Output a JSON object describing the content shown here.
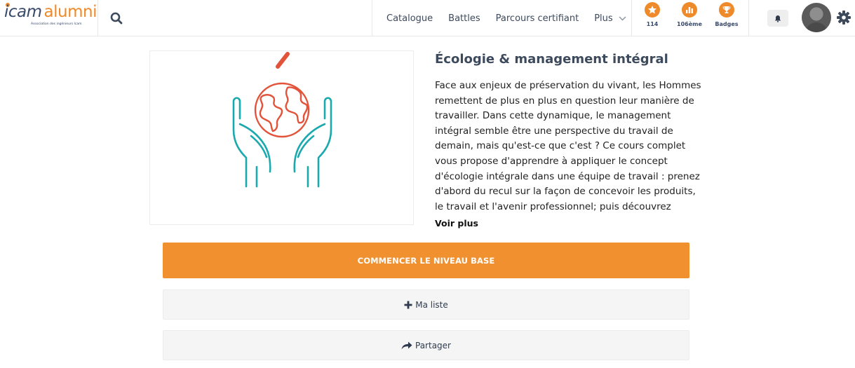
{
  "header": {
    "logo_word1": "icam",
    "logo_word2": "alumni",
    "logo_tagline": "Association des ingénieurs Icam",
    "nav": [
      {
        "label": "Catalogue"
      },
      {
        "label": "Battles"
      },
      {
        "label": "Parcours certifiant"
      },
      {
        "label": "Plus"
      }
    ],
    "stats": [
      {
        "label": "114",
        "icon": "star-icon"
      },
      {
        "label": "106ème",
        "icon": "ranking-icon"
      },
      {
        "label": "Badges",
        "icon": "trophy-icon"
      }
    ]
  },
  "course": {
    "title": "Écologie & management intégral",
    "description": "Face aux enjeux de préservation du vivant, les Hommes remettent de plus en plus en question leur manière de travailler. Dans cette dynamique, le management intégral semble être une perspective du travail de demain, mais qu'est-ce que c'est ? Ce cours complet vous propose d'apprendre à appliquer le concept d'écologie intégrale dans une équipe de travail : prenez d'abord du recul sur la façon de concevoir les produits, le travail et l'avenir professionnel; puis découvrez",
    "see_more": "Voir plus",
    "start_button": "COMMENCER LE NIVEAU BASE",
    "my_list_button": "Ma liste",
    "share_button": "Partager"
  },
  "colors": {
    "accent": "#f0902f",
    "text_dark": "#3d4a5c",
    "illustration_teal": "#1ba9ad",
    "illustration_red": "#e2533a"
  }
}
